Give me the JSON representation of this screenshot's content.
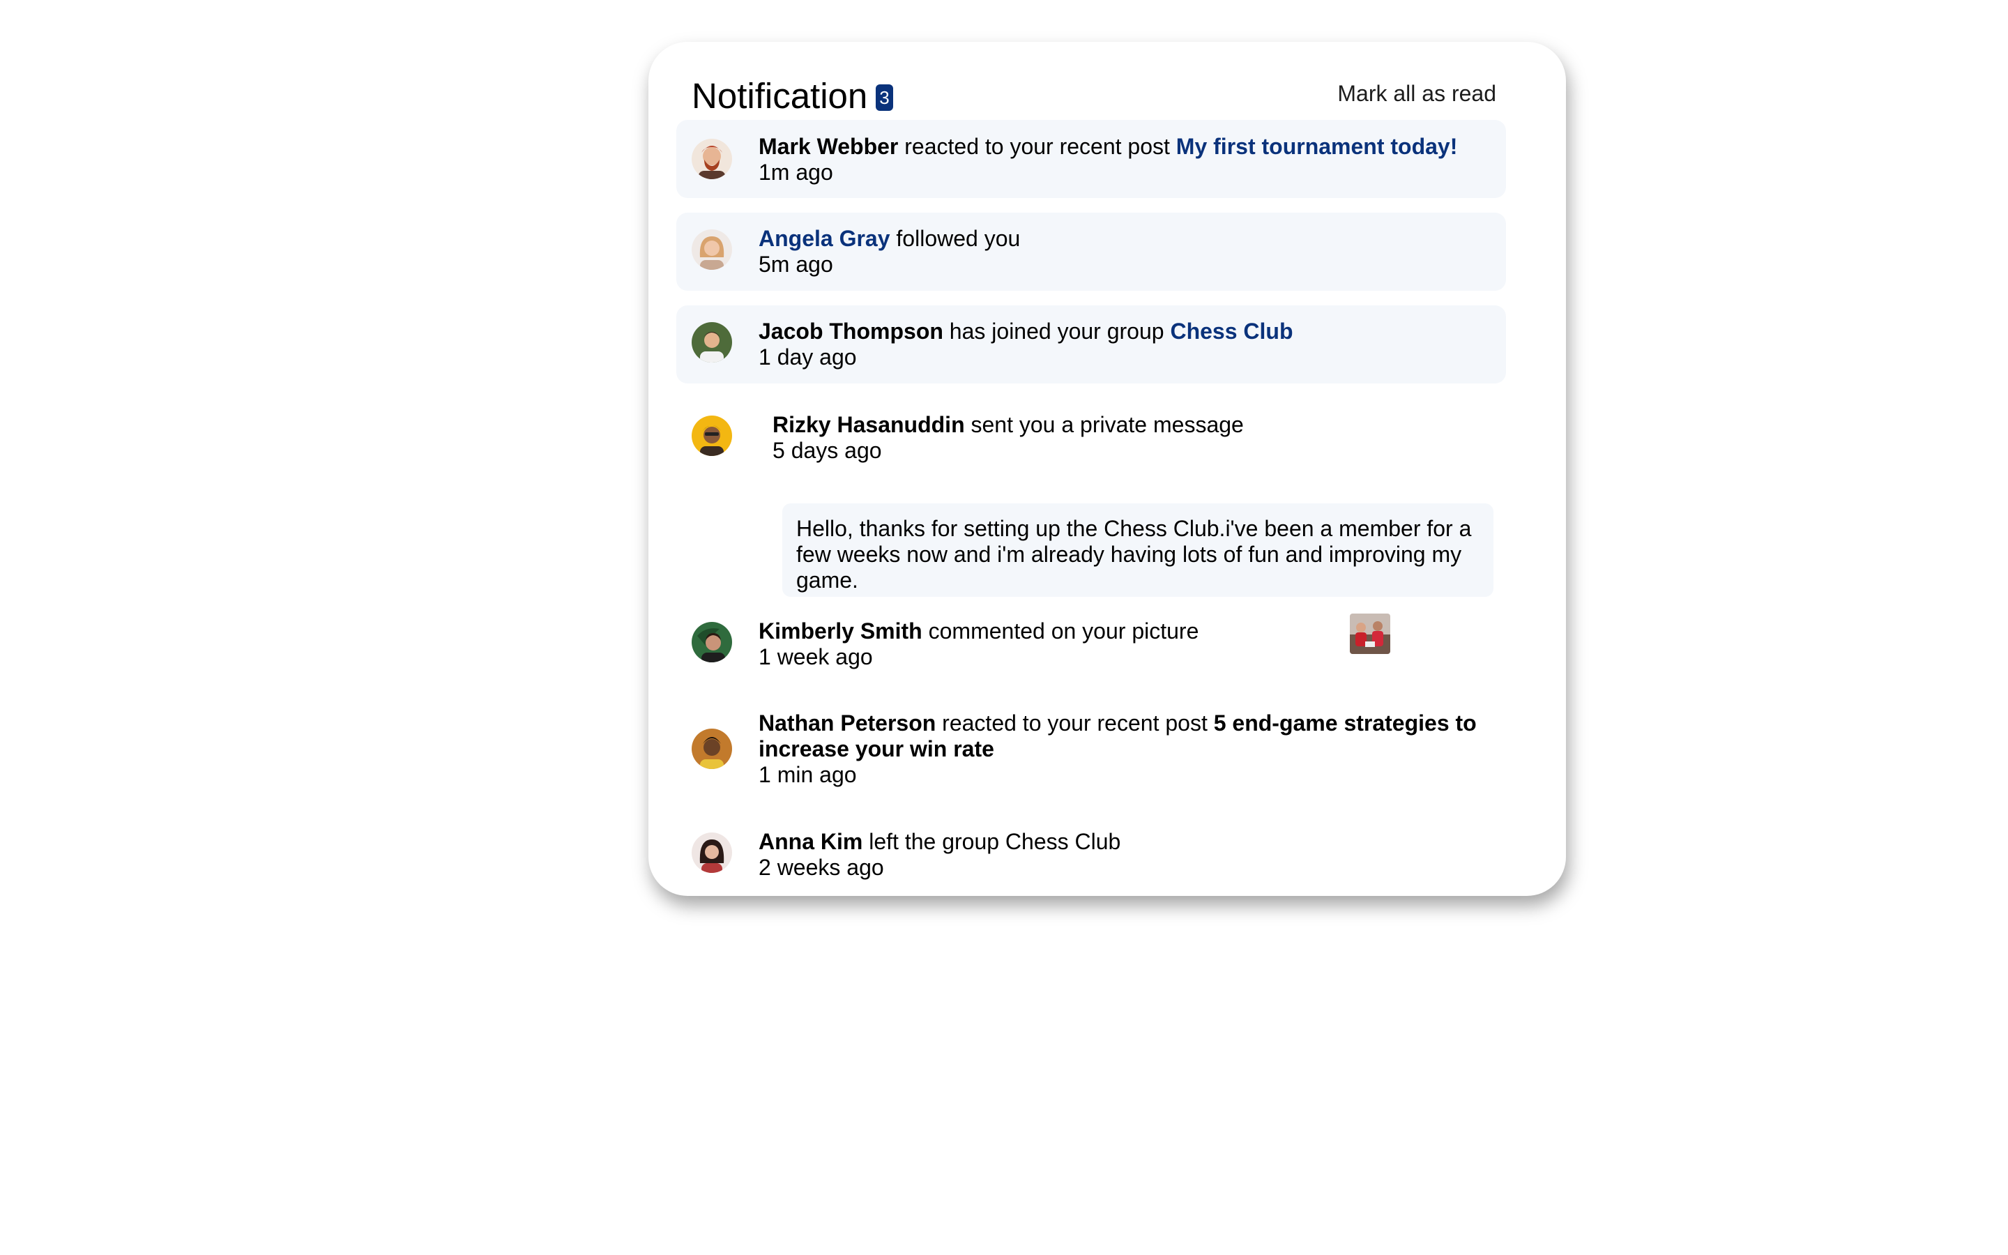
{
  "header": {
    "title": "Notification",
    "unread_count": "3",
    "mark_all_label": "Mark all as read"
  },
  "notifications": [
    {
      "actor": "Mark Webber",
      "action": " reacted to your recent post ",
      "target": "My first tournament today!",
      "time": "1m ago",
      "unread": true,
      "avatar_icon": "mark-webber-avatar"
    },
    {
      "actor": "Angela Gray",
      "action": " followed you",
      "time": "5m ago",
      "unread": true,
      "avatar_icon": "angela-gray-avatar"
    },
    {
      "actor": "Jacob Thompson",
      "action": " has joined your group ",
      "target": "Chess Club",
      "time": "1 day ago",
      "unread": true,
      "avatar_icon": "jacob-thompson-avatar"
    },
    {
      "actor": "Rizky Hasanuddin",
      "action": " sent you a private message",
      "time": "5 days ago",
      "unread": false,
      "avatar_icon": "rizky-hasanuddin-avatar",
      "message": "Hello, thanks for setting up the Chess Club.i've been a member for a few weeks now and i'm already having lots of fun and improving my game."
    },
    {
      "actor": "Kimberly Smith",
      "action": " commented on your picture",
      "time": "1 week ago",
      "unread": false,
      "avatar_icon": "kimberly-smith-avatar",
      "picture_icon": "chess-picture-thumbnail"
    },
    {
      "actor": "Nathan Peterson",
      "action": " reacted to your recent post ",
      "target": "5 end-game strategies to increase your win rate",
      "time": "1 min ago",
      "unread": false,
      "avatar_icon": "nathan-peterson-avatar"
    },
    {
      "actor": "Anna Kim",
      "action": " left the group Chess Club",
      "time": "2 weeks ago",
      "unread": false,
      "avatar_icon": "anna-kim-avatar"
    }
  ],
  "colors": {
    "accent": "#0a327b",
    "unread_background": "#f4f7fb",
    "card_background": "#ffffff"
  }
}
